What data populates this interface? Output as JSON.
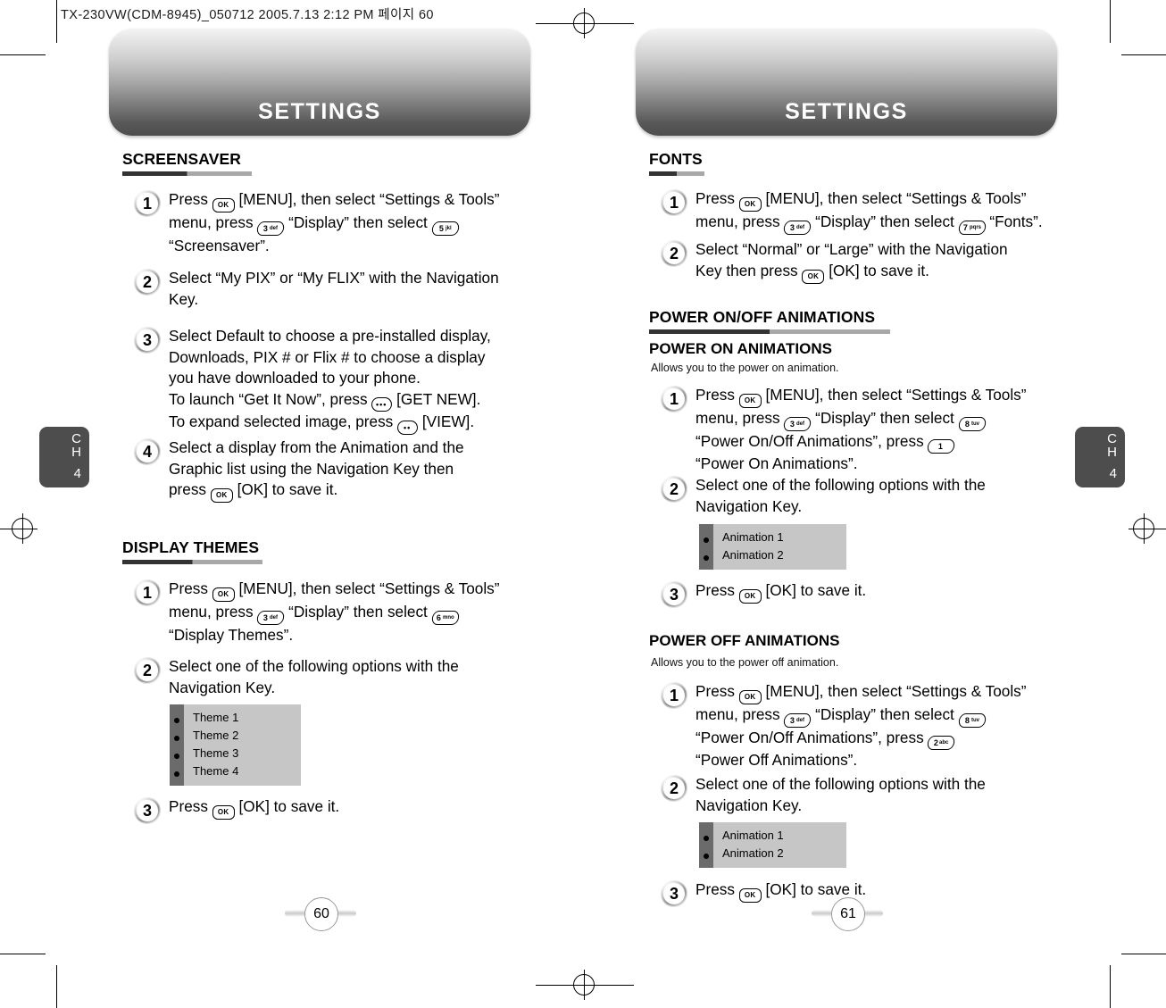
{
  "document": {
    "file_info": "TX-230VW(CDM-8945)_050712  2005.7.13 2:12 PM  페이지 60",
    "banner_title_left": "SETTINGS",
    "banner_title_right": "SETTINGS",
    "chapter_tab": {
      "ch_line1": "C",
      "ch_line2": "H",
      "number": "4"
    },
    "page_number_left": "60",
    "page_number_right": "61"
  },
  "keys": {
    "ok": "OK",
    "k1": {
      "digit": "1",
      "letters": ""
    },
    "k2": {
      "digit": "2",
      "letters": "abc"
    },
    "k3": {
      "digit": "3",
      "letters": "def"
    },
    "k5": {
      "digit": "5",
      "letters": "jkl"
    },
    "k6": {
      "digit": "6",
      "letters": "mno"
    },
    "k7": {
      "digit": "7",
      "letters": "pqrs"
    },
    "k8": {
      "digit": "8",
      "letters": "tuv"
    },
    "soft_get_new": "•••",
    "soft_view": "••"
  },
  "left_page": {
    "sections": [
      {
        "heading": "SCREENSAVER",
        "steps": [
          {
            "number": "1",
            "lines": [
              {
                "parts": [
                  {
                    "t": "text",
                    "v": "Press "
                  },
                  {
                    "t": "key_ok"
                  },
                  {
                    "t": "text",
                    "v": " [MENU], then select “Settings & Tools”"
                  }
                ]
              },
              {
                "parts": [
                  {
                    "t": "text",
                    "v": "menu, press "
                  },
                  {
                    "t": "key_num",
                    "digit": "3",
                    "letters": "def"
                  },
                  {
                    "t": "text",
                    "v": " “Display” then select "
                  },
                  {
                    "t": "key_num",
                    "digit": "5",
                    "letters": "jkl"
                  }
                ]
              },
              {
                "parts": [
                  {
                    "t": "text",
                    "v": "“Screensaver”."
                  }
                ]
              }
            ]
          },
          {
            "number": "2",
            "lines": [
              {
                "parts": [
                  {
                    "t": "text",
                    "v": "Select “My PIX” or “My FLIX” with the Navigation"
                  }
                ]
              },
              {
                "parts": [
                  {
                    "t": "text",
                    "v": "Key."
                  }
                ]
              }
            ]
          },
          {
            "number": "3",
            "lines": [
              {
                "parts": [
                  {
                    "t": "text",
                    "v": "Select Default to choose a pre-installed display,"
                  }
                ]
              },
              {
                "parts": [
                  {
                    "t": "text",
                    "v": "Downloads, PIX # or Flix # to choose a display"
                  }
                ]
              },
              {
                "parts": [
                  {
                    "t": "text",
                    "v": "you have downloaded to your phone."
                  }
                ]
              },
              {
                "parts": [
                  {
                    "t": "text",
                    "v": "To launch “Get It Now”, press "
                  },
                  {
                    "t": "key_soft",
                    "v": "•••"
                  },
                  {
                    "t": "text",
                    "v": " [GET NEW]."
                  }
                ]
              },
              {
                "parts": [
                  {
                    "t": "text",
                    "v": "To expand selected image, press "
                  },
                  {
                    "t": "key_soft",
                    "v": "••"
                  },
                  {
                    "t": "text",
                    "v": " [VIEW]."
                  }
                ]
              }
            ]
          },
          {
            "number": "4",
            "lines": [
              {
                "parts": [
                  {
                    "t": "text",
                    "v": "Select a display from the Animation and the"
                  }
                ]
              },
              {
                "parts": [
                  {
                    "t": "text",
                    "v": "Graphic list using the Navigation Key then"
                  }
                ]
              },
              {
                "parts": [
                  {
                    "t": "text",
                    "v": "press "
                  },
                  {
                    "t": "key_ok"
                  },
                  {
                    "t": "text",
                    "v": " [OK] to save it."
                  }
                ]
              }
            ]
          }
        ]
      },
      {
        "heading": "DISPLAY THEMES",
        "steps": [
          {
            "number": "1",
            "lines": [
              {
                "parts": [
                  {
                    "t": "text",
                    "v": "Press "
                  },
                  {
                    "t": "key_ok"
                  },
                  {
                    "t": "text",
                    "v": " [MENU], then select “Settings & Tools”"
                  }
                ]
              },
              {
                "parts": [
                  {
                    "t": "text",
                    "v": "menu, press "
                  },
                  {
                    "t": "key_num",
                    "digit": "3",
                    "letters": "def"
                  },
                  {
                    "t": "text",
                    "v": " “Display” then select "
                  },
                  {
                    "t": "key_num",
                    "digit": "6",
                    "letters": "mno"
                  }
                ]
              },
              {
                "parts": [
                  {
                    "t": "text",
                    "v": "“Display Themes”."
                  }
                ]
              }
            ]
          },
          {
            "number": "2",
            "lines": [
              {
                "parts": [
                  {
                    "t": "text",
                    "v": "Select one of the following options with the"
                  }
                ]
              },
              {
                "parts": [
                  {
                    "t": "text",
                    "v": "Navigation Key."
                  }
                ]
              }
            ]
          },
          {
            "number": "3",
            "lines": [
              {
                "parts": [
                  {
                    "t": "text",
                    "v": "Press "
                  },
                  {
                    "t": "key_ok"
                  },
                  {
                    "t": "text",
                    "v": " [OK] to save it."
                  }
                ]
              }
            ]
          }
        ]
      }
    ],
    "theme_options": [
      "Theme 1",
      "Theme 2",
      "Theme 3",
      "Theme 4"
    ]
  },
  "right_page": {
    "fonts_heading": "FONTS",
    "fonts_steps": [
      {
        "number": "1",
        "lines": [
          {
            "parts": [
              {
                "t": "text",
                "v": "Press "
              },
              {
                "t": "key_ok"
              },
              {
                "t": "text",
                "v": " [MENU], then select “Settings & Tools”"
              }
            ]
          },
          {
            "parts": [
              {
                "t": "text",
                "v": "menu, press "
              },
              {
                "t": "key_num",
                "digit": "3",
                "letters": "def"
              },
              {
                "t": "text",
                "v": " “Display” then select "
              },
              {
                "t": "key_num",
                "digit": "7",
                "letters": "pqrs"
              },
              {
                "t": "text",
                "v": " “Fonts”."
              }
            ]
          }
        ]
      },
      {
        "number": "2",
        "lines": [
          {
            "parts": [
              {
                "t": "text",
                "v": "Select “Normal” or “Large” with the Navigation"
              }
            ]
          },
          {
            "parts": [
              {
                "t": "text",
                "v": "Key then press "
              },
              {
                "t": "key_ok"
              },
              {
                "t": "text",
                "v": " [OK] to save it."
              }
            ]
          }
        ]
      }
    ],
    "power_heading": "POWER ON/OFF ANIMATIONS",
    "power_on": {
      "subheading": "POWER ON ANIMATIONS",
      "note": "Allows you to the power on animation.",
      "steps": [
        {
          "number": "1",
          "lines": [
            {
              "parts": [
                {
                  "t": "text",
                  "v": "Press "
                },
                {
                  "t": "key_ok"
                },
                {
                  "t": "text",
                  "v": " [MENU], then select “Settings & Tools”"
                }
              ]
            },
            {
              "parts": [
                {
                  "t": "text",
                  "v": "menu, press "
                },
                {
                  "t": "key_num",
                  "digit": "3",
                  "letters": "def"
                },
                {
                  "t": "text",
                  "v": " “Display” then select "
                },
                {
                  "t": "key_num",
                  "digit": "8",
                  "letters": "tuv"
                }
              ]
            },
            {
              "parts": [
                {
                  "t": "text",
                  "v": "“Power On/Off Animations”, press "
                },
                {
                  "t": "key_num",
                  "digit": "1",
                  "letters": ""
                }
              ]
            },
            {
              "parts": [
                {
                  "t": "text",
                  "v": "“Power On Animations”."
                }
              ]
            }
          ]
        },
        {
          "number": "2",
          "lines": [
            {
              "parts": [
                {
                  "t": "text",
                  "v": "Select one of the following options with the"
                }
              ]
            },
            {
              "parts": [
                {
                  "t": "text",
                  "v": "Navigation Key."
                }
              ]
            }
          ]
        },
        {
          "number": "3",
          "lines": [
            {
              "parts": [
                {
                  "t": "text",
                  "v": "Press "
                },
                {
                  "t": "key_ok"
                },
                {
                  "t": "text",
                  "v": " [OK] to save it."
                }
              ]
            }
          ]
        }
      ],
      "options": [
        "Animation 1",
        "Animation 2"
      ]
    },
    "power_off": {
      "subheading": "POWER OFF ANIMATIONS",
      "note": "Allows you to the power off animation.",
      "steps": [
        {
          "number": "1",
          "lines": [
            {
              "parts": [
                {
                  "t": "text",
                  "v": "Press "
                },
                {
                  "t": "key_ok"
                },
                {
                  "t": "text",
                  "v": " [MENU], then select “Settings & Tools”"
                }
              ]
            },
            {
              "parts": [
                {
                  "t": "text",
                  "v": "menu, press "
                },
                {
                  "t": "key_num",
                  "digit": "3",
                  "letters": "def"
                },
                {
                  "t": "text",
                  "v": " “Display” then select "
                },
                {
                  "t": "key_num",
                  "digit": "8",
                  "letters": "tuv"
                }
              ]
            },
            {
              "parts": [
                {
                  "t": "text",
                  "v": "“Power On/Off Animations”, press "
                },
                {
                  "t": "key_num",
                  "digit": "2",
                  "letters": "abc"
                }
              ]
            },
            {
              "parts": [
                {
                  "t": "text",
                  "v": "“Power Off  Animations”."
                }
              ]
            }
          ]
        },
        {
          "number": "2",
          "lines": [
            {
              "parts": [
                {
                  "t": "text",
                  "v": "Select one of the following options with the"
                }
              ]
            },
            {
              "parts": [
                {
                  "t": "text",
                  "v": "Navigation Key."
                }
              ]
            }
          ]
        },
        {
          "number": "3",
          "lines": [
            {
              "parts": [
                {
                  "t": "text",
                  "v": "Press "
                },
                {
                  "t": "key_ok"
                },
                {
                  "t": "text",
                  "v": " [OK] to save it."
                }
              ]
            }
          ]
        }
      ],
      "options": [
        "Animation 1",
        "Animation 2"
      ]
    }
  }
}
